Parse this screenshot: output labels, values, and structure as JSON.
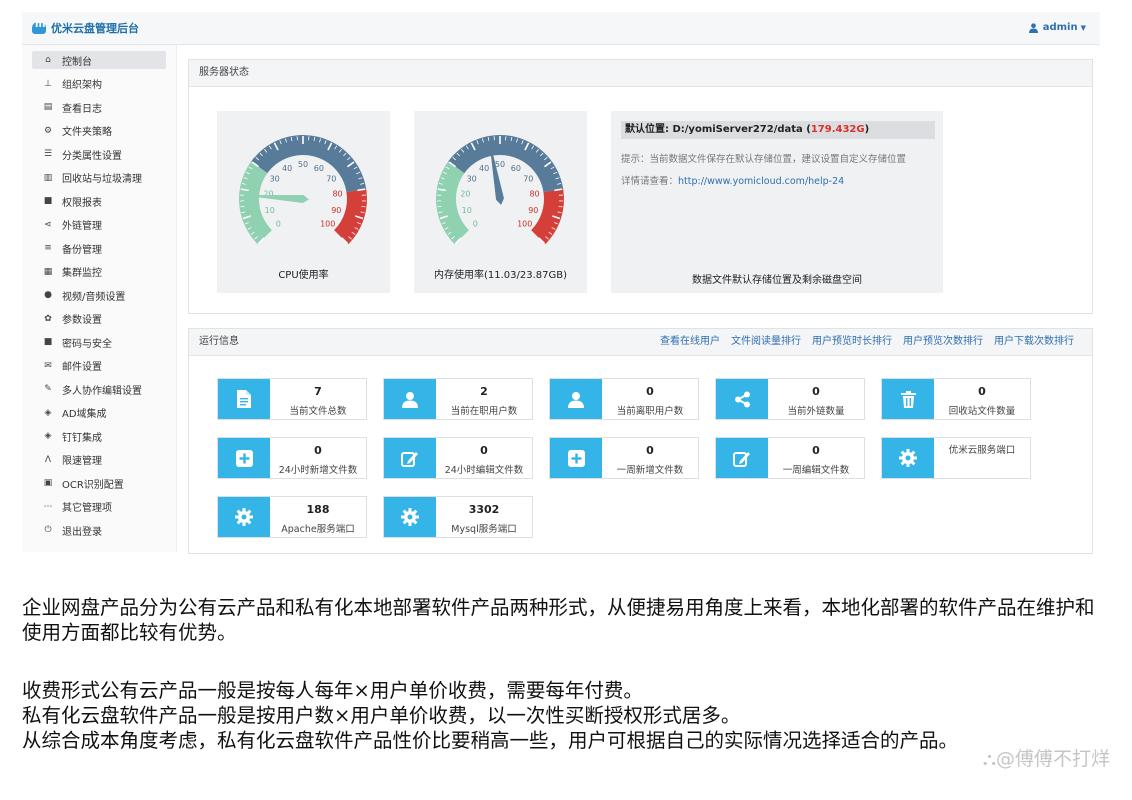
{
  "header": {
    "title": "优米云盘管理后台",
    "user": "admin"
  },
  "sidebar": {
    "items": [
      {
        "label": "控制台",
        "icon": "home-icon",
        "glyph": "⌂",
        "active": true
      },
      {
        "label": "组织架构",
        "icon": "org-chart-icon",
        "glyph": "⊥"
      },
      {
        "label": "查看日志",
        "icon": "log-file-icon",
        "glyph": "▤"
      },
      {
        "label": "文件夹策略",
        "icon": "cogs-icon",
        "glyph": "⚙"
      },
      {
        "label": "分类属性设置",
        "icon": "list-icon",
        "glyph": "☰"
      },
      {
        "label": "回收站与垃圾清理",
        "icon": "trash-icon",
        "glyph": "▥"
      },
      {
        "label": "权限报表",
        "icon": "lock-icon",
        "glyph": "■"
      },
      {
        "label": "外链管理",
        "icon": "share-icon",
        "glyph": "⋖"
      },
      {
        "label": "备份管理",
        "icon": "database-icon",
        "glyph": "≡"
      },
      {
        "label": "集群监控",
        "icon": "server-icon",
        "glyph": "▦"
      },
      {
        "label": "视频/音频设置",
        "icon": "play-circle-icon",
        "glyph": "●"
      },
      {
        "label": "参数设置",
        "icon": "gear-icon",
        "glyph": "✿"
      },
      {
        "label": "密码与安全",
        "icon": "padlock-icon",
        "glyph": "■"
      },
      {
        "label": "邮件设置",
        "icon": "envelope-icon",
        "glyph": "✉"
      },
      {
        "label": "多人协作编辑设置",
        "icon": "edit-icon",
        "glyph": "✎"
      },
      {
        "label": "AD域集成",
        "icon": "cube-icon",
        "glyph": "◈"
      },
      {
        "label": "钉钉集成",
        "icon": "cube-icon",
        "glyph": "◈"
      },
      {
        "label": "限速管理",
        "icon": "road-icon",
        "glyph": "Ʌ"
      },
      {
        "label": "OCR识别配置",
        "icon": "ocr-file-icon",
        "glyph": "▣"
      },
      {
        "label": "其它管理项",
        "icon": "ellipsis-icon",
        "glyph": "⋯"
      },
      {
        "label": "退出登录",
        "icon": "power-icon",
        "glyph": "⏻"
      }
    ]
  },
  "server_status": {
    "title": "服务器状态",
    "gauge_ticks": [
      "0",
      "10",
      "20",
      "30",
      "40",
      "50",
      "60",
      "70",
      "80",
      "90",
      "100"
    ],
    "cpu": {
      "caption": "CPU使用率",
      "value": 18
    },
    "memory": {
      "caption": "内存使用率(11.03/23.87GB)",
      "value": 46.2
    },
    "storage": {
      "location_label": "默认位置: D:/yomiServer272/data (",
      "free_space": "179.432G",
      "close_paren": ")",
      "hint": "提示：当前数据文件保存在默认存储位置，建议设置自定义存储位置",
      "detail_prefix": "详情请查看：",
      "detail_link": "http://www.yomicloud.com/help-24",
      "caption": "数据文件默认存储位置及剩余磁盘空间"
    }
  },
  "runtime": {
    "title": "运行信息",
    "links": [
      "查看在线用户",
      "文件阅读量排行",
      "用户预览时长排行",
      "用户预览次数排行",
      "用户下载次数排行"
    ],
    "cards": [
      {
        "value": "7",
        "label": "当前文件总数",
        "icon": "file-icon"
      },
      {
        "value": "2",
        "label": "当前在职用户数",
        "icon": "user-icon"
      },
      {
        "value": "0",
        "label": "当前离职用户数",
        "icon": "user-icon"
      },
      {
        "value": "0",
        "label": "当前外链数量",
        "icon": "share-icon"
      },
      {
        "value": "0",
        "label": "回收站文件数量",
        "icon": "trash-icon"
      },
      {
        "value": "0",
        "label": "24小时新增文件数",
        "icon": "plus-square-icon"
      },
      {
        "value": "0",
        "label": "24小时编辑文件数",
        "icon": "edit-icon"
      },
      {
        "value": "0",
        "label": "一周新增文件数",
        "icon": "plus-square-icon"
      },
      {
        "value": "0",
        "label": "一周编辑文件数",
        "icon": "edit-icon"
      },
      {
        "value": "",
        "label": "优米云服务端口",
        "icon": "gear-icon"
      },
      {
        "value": "188",
        "label": "Apache服务端口",
        "icon": "gear-icon"
      },
      {
        "value": "3302",
        "label": "Mysql服务端口",
        "icon": "gear-icon"
      }
    ]
  },
  "article": {
    "p1": "企业网盘产品分为公有云产品和私有化本地部署软件产品两种形式，从便捷易用角度上来看，本地化部署的软件产品在维护和使用方面都比较有优势。",
    "p2_line1": "收费形式公有云产品一般是按每人每年×用户单价收费，需要每年付费。",
    "p2_line2": "私有化云盘软件产品一般是按用户数×用户单价收费，以一次性买断授权形式居多。",
    "p2_line3": "从综合成本角度考虑，私有化云盘软件产品性价比要稍高一些，用户可根据自己的实际情况选择适合的产品。"
  },
  "watermark": "⛬@傅傅不打烊",
  "colors": {
    "accent": "#35b4e8",
    "gauge_green": "#8fd1b1",
    "gauge_blue": "#587b99",
    "gauge_red": "#d43f3a",
    "link": "#2f6fb2"
  }
}
